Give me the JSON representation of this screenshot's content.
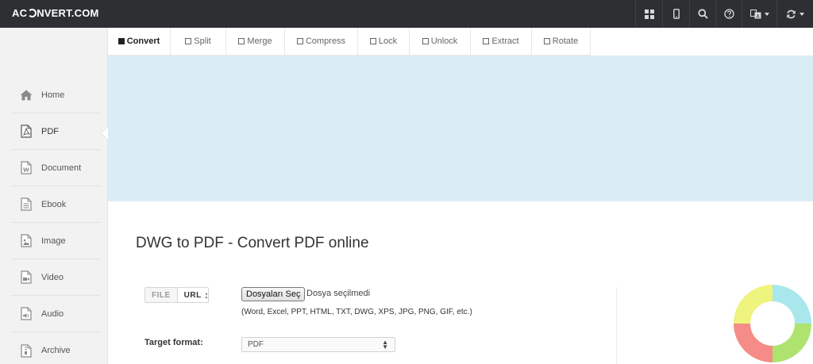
{
  "app": {
    "logo_text_left": "AC",
    "logo_text_right": "NVERT.COM"
  },
  "topbar": {
    "icons": [
      "grid-icon",
      "mobile-icon",
      "search-icon",
      "help-icon",
      "language-icon",
      "refresh-icon"
    ]
  },
  "tabs": [
    {
      "label": "Convert",
      "active": true
    },
    {
      "label": "Split",
      "active": false
    },
    {
      "label": "Merge",
      "active": false
    },
    {
      "label": "Compress",
      "active": false
    },
    {
      "label": "Lock",
      "active": false
    },
    {
      "label": "Unlock",
      "active": false
    },
    {
      "label": "Extract",
      "active": false
    },
    {
      "label": "Rotate",
      "active": false
    }
  ],
  "sidebar": {
    "items": [
      {
        "label": "Home",
        "icon": "home-icon"
      },
      {
        "label": "PDF",
        "icon": "pdf-icon",
        "active": true
      },
      {
        "label": "Document",
        "icon": "document-icon"
      },
      {
        "label": "Ebook",
        "icon": "ebook-icon"
      },
      {
        "label": "Image",
        "icon": "image-icon"
      },
      {
        "label": "Video",
        "icon": "video-icon"
      },
      {
        "label": "Audio",
        "icon": "audio-icon"
      },
      {
        "label": "Archive",
        "icon": "archive-icon"
      }
    ]
  },
  "main": {
    "title": "DWG to PDF - Convert PDF online",
    "source_toggle": {
      "file_label": "FILE",
      "url_label": "URL",
      "colon": ":"
    },
    "file_input": {
      "button_label": "Dosyaları Seç",
      "status": "Dosya seçilmedi"
    },
    "formats_hint": "(Word, Excel, PPT, HTML, TXT, DWG, XPS, JPG, PNG, GIF, etc.)",
    "target_format": {
      "label": "Target format:",
      "value": "PDF"
    }
  },
  "colors": {
    "topbar_bg": "#2d2f33",
    "sidebar_bg": "#f2f2f2",
    "banner_bg": "#d8edf6",
    "donut": [
      "#a9e7ec",
      "#aee36f",
      "#f58c87",
      "#eef47d"
    ]
  }
}
